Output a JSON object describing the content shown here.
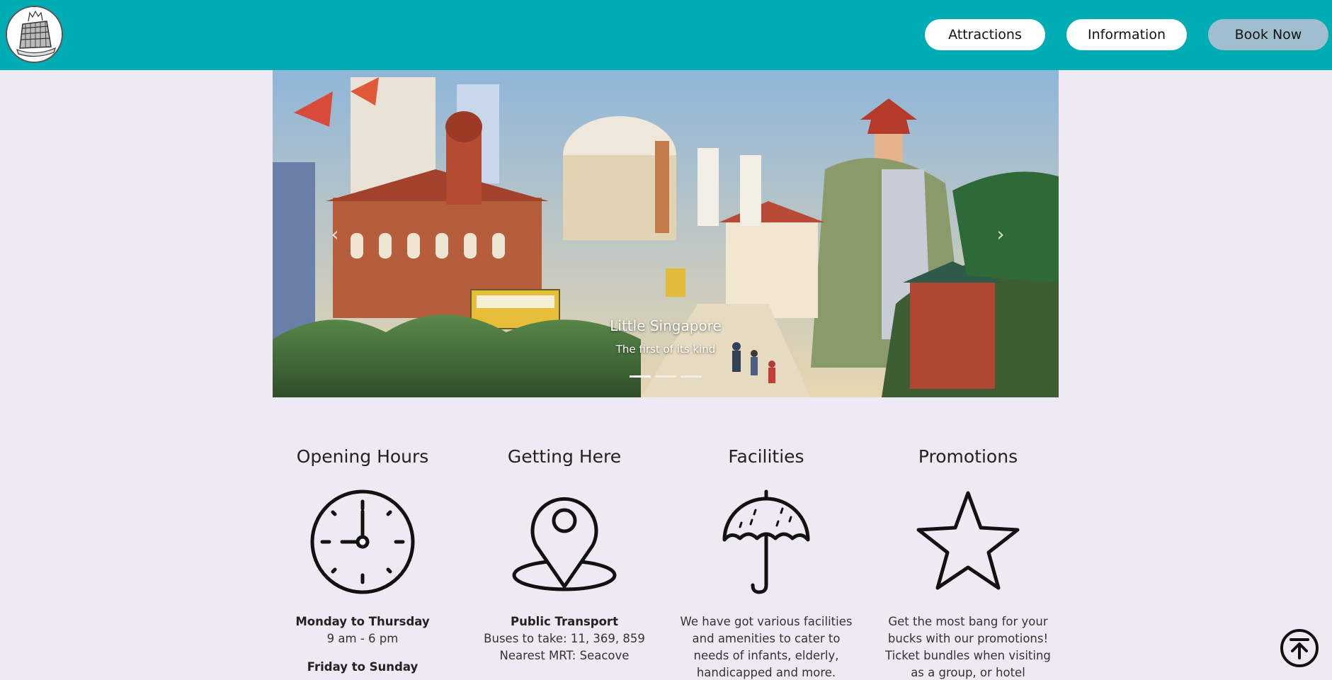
{
  "nav": {
    "logo_icon": "colosseum-logo-icon",
    "attractions": "Attractions",
    "information": "Information",
    "book_now": "Book Now"
  },
  "carousel": {
    "title": "Little Singapore",
    "subtitle": "The first of its kind",
    "slide_count": 3,
    "active_slide": 1
  },
  "sections": {
    "hours": {
      "title": "Opening Hours",
      "icon": "clock-icon",
      "weekday_label": "Monday to Thursday",
      "weekday_hours": "9 am - 6 pm",
      "weekend_label": "Friday to Sunday"
    },
    "getting_here": {
      "title": "Getting Here",
      "icon": "map-pin-icon",
      "transport_label": "Public Transport",
      "buses": "Buses to take: 11, 369, 859",
      "mrt": "Nearest MRT: Seacove"
    },
    "facilities": {
      "title": "Facilities",
      "icon": "umbrella-icon",
      "line1": "We have got various facilities",
      "line2": "and amenities to cater to",
      "line3": "needs of infants, elderly,",
      "line4": "handicapped and more."
    },
    "promotions": {
      "title": "Promotions",
      "icon": "star-icon",
      "line1": "Get the most bang for your",
      "line2": "bucks with our promotions!",
      "line3": "Ticket bundles when visiting",
      "line4": "as a group, or hotel"
    }
  },
  "colors": {
    "navbar": "#00acb3",
    "page_bg": "#efe9f3",
    "book_now_bg": "#9fbfcf"
  },
  "back_to_top_icon": "arrow-up-circle-icon"
}
